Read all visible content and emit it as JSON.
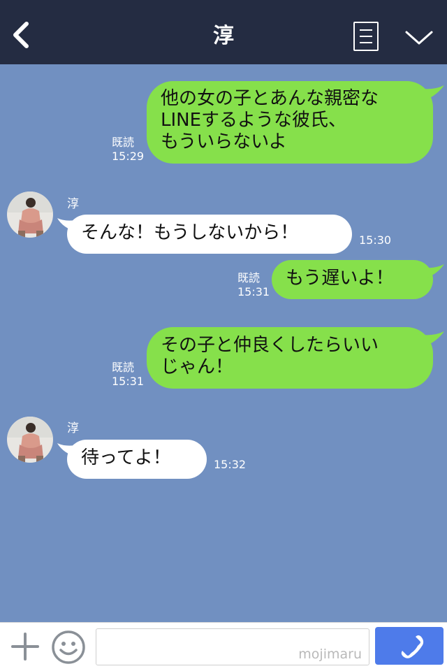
{
  "header": {
    "title": "淳",
    "back_icon": "chevron-left-icon",
    "menu_icon": "notes-icon",
    "more_icon": "chevron-down-icon"
  },
  "messages": [
    {
      "side": "out",
      "lines": [
        "他の女の子とあんな親密な",
        "LINEするような彼氏、",
        "もういらないよ"
      ],
      "read": "既読",
      "time": "15:29"
    },
    {
      "side": "in",
      "sender": "淳",
      "text": "そんな！もうしないから！",
      "time": "15:30"
    },
    {
      "side": "out",
      "lines": [
        "もう遅いよ！"
      ],
      "read": "既読",
      "time": "15:31"
    },
    {
      "side": "out",
      "lines": [
        "その子と仲良くしたらいい",
        "じゃん！"
      ],
      "read": "既読",
      "time": "15:31"
    },
    {
      "side": "in",
      "sender": "淳",
      "text": "待ってよ！",
      "time": "15:32"
    }
  ],
  "input_bar": {
    "plus_icon": "plus-icon",
    "emoji_icon": "smiley-icon",
    "watermark": "mojimaru",
    "call_icon": "phone-icon"
  },
  "colors": {
    "header_bg": "#242c42",
    "chat_bg": "#7190c1",
    "outgoing_bubble": "#86e04b",
    "incoming_bubble": "#ffffff",
    "call_button": "#4e7bea"
  }
}
